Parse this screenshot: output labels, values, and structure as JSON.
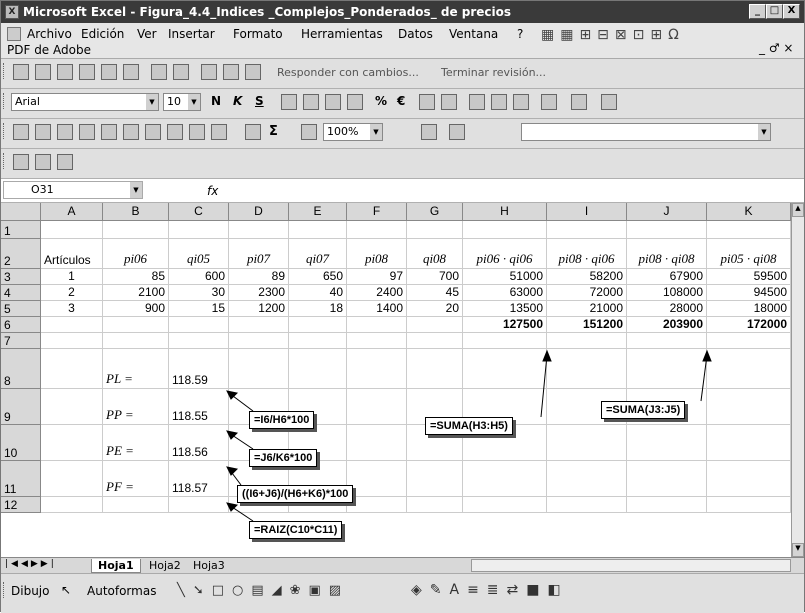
{
  "window": {
    "title": "Microsoft Excel - Figura_4.4_Indices _Complejos_Ponderados_ de precios",
    "controls": [
      "_",
      "□",
      "X"
    ]
  },
  "menu": {
    "items": [
      "Archivo",
      "Edición",
      "Ver",
      "Insertar",
      "Formato",
      "Herramientas",
      "Datos",
      "Ventana",
      "?"
    ],
    "second_row": "PDF de Adobe",
    "mdi_controls": "_ ♂ ×"
  },
  "review_toolbar": {
    "text": "Responder con cambios...",
    "end_review": "Terminar revisión..."
  },
  "format_toolbar": {
    "font": "Arial",
    "size": "10",
    "bold": "N",
    "italic": "K",
    "underline": "S",
    "percent": "%",
    "euro": "€"
  },
  "standard_toolbar": {
    "zoom": "100%",
    "sigma": "Σ"
  },
  "formula_bar": {
    "name_box": "O31",
    "fx": "fx",
    "value": ""
  },
  "columns": [
    "A",
    "B",
    "C",
    "D",
    "E",
    "F",
    "G",
    "H",
    "I",
    "J",
    "K"
  ],
  "rows": [
    "1",
    "2",
    "3",
    "4",
    "5",
    "6",
    "7",
    "8",
    "9",
    "10",
    "11",
    "12"
  ],
  "headers": {
    "A": "Artículos",
    "B": "pi06",
    "C": "qi05",
    "D": "pi07",
    "E": "qi07",
    "F": "pi08",
    "G": "qi08",
    "H": "pi06 · qi06",
    "I": "pi08 · qi06",
    "J": "pi08 · qi08",
    "K": "pi05 · qi08"
  },
  "data": [
    {
      "A": "1",
      "B": "85",
      "C": "600",
      "D": "89",
      "E": "650",
      "F": "97",
      "G": "700",
      "H": "51000",
      "I": "58200",
      "J": "67900",
      "K": "59500"
    },
    {
      "A": "2",
      "B": "2100",
      "C": "30",
      "D": "2300",
      "E": "40",
      "F": "2400",
      "G": "45",
      "H": "63000",
      "I": "72000",
      "J": "108000",
      "K": "94500"
    },
    {
      "A": "3",
      "B": "900",
      "C": "15",
      "D": "1200",
      "E": "18",
      "F": "1400",
      "G": "20",
      "H": "13500",
      "I": "21000",
      "J": "28000",
      "K": "18000"
    }
  ],
  "totals": {
    "H": "127500",
    "I": "151200",
    "J": "203900",
    "K": "172000"
  },
  "indices": [
    {
      "label": "PL =",
      "value": "118.59",
      "formula": "=I6/H6*100"
    },
    {
      "label": "PP =",
      "value": "118.55",
      "formula": "=J6/K6*100"
    },
    {
      "label": "PE =",
      "value": "118.56",
      "formula": "((I6+J6)/(H6+K6)*100"
    },
    {
      "label": "PF =",
      "value": "118.57",
      "formula": "=RAIZ(C10*C11)"
    }
  ],
  "callouts": {
    "sum_h": "=SUMA(H3:H5)",
    "sum_j": "=SUMA(J3:J5)"
  },
  "sheet_tabs": [
    "Hoja1",
    "Hoja2",
    "Hoja3"
  ],
  "drawing_toolbar": {
    "draw": "Dibujo",
    "autoshapes": "Autoformas"
  }
}
